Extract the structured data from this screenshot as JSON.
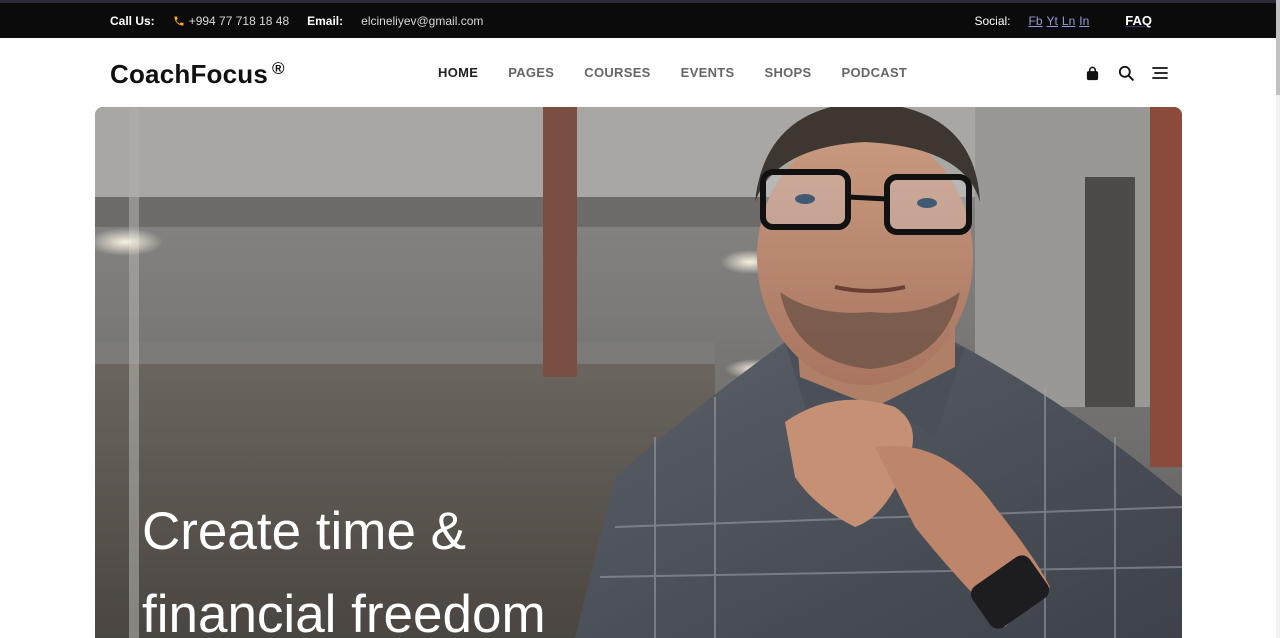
{
  "topbar": {
    "call_label": "Call Us:",
    "phone": "+994 77 718 18 48",
    "email_label": "Email:",
    "email": "elcineliyev@gmail.com",
    "social_label": "Social:",
    "social_links": [
      "Fb",
      "Yt",
      "Ln",
      "In"
    ],
    "faq": "FAQ"
  },
  "header": {
    "logo": "CoachFocus",
    "logo_mark": "®",
    "nav": [
      {
        "label": "HOME",
        "active": true
      },
      {
        "label": "PAGES",
        "active": false
      },
      {
        "label": "COURSES",
        "active": false
      },
      {
        "label": "EVENTS",
        "active": false
      },
      {
        "label": "SHOPS",
        "active": false
      },
      {
        "label": "PODCAST",
        "active": false
      }
    ],
    "icons": [
      "bag-icon",
      "search-icon",
      "menu-icon"
    ]
  },
  "hero": {
    "title_line1": "Create time &",
    "title_line2": "financial freedom"
  },
  "colors": {
    "topbar_bg": "#0b0b0b",
    "phone_icon": "#f5a623",
    "social_link": "#9a9ad4",
    "nav_active": "#222222",
    "nav_inactive": "#666666"
  }
}
